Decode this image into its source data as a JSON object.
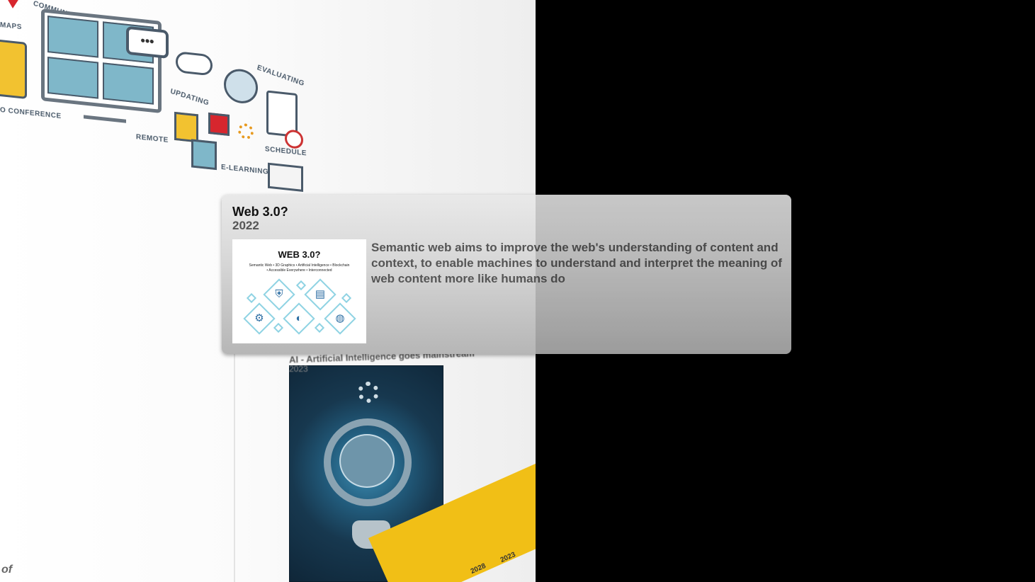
{
  "popup": {
    "title": "Web 3.0?",
    "year": "2022",
    "thumbnail": {
      "heading": "WEB 3.0?",
      "subtitle_line1": "Semantic Web • 3D Graphics • Artificial Intelligence • Blockchain",
      "subtitle_line2": "• Accessible Everywhere • Interconnected",
      "icons": [
        "shield-lock-icon",
        "document-search-icon",
        "gear-network-icon",
        "3d-face-icon",
        "globe-hand-icon"
      ]
    },
    "description": "Semantic web aims to improve the web's understanding of content and context, to enable machines to understand and interpret the meaning of web content more like humans do"
  },
  "background": {
    "collage_labels": [
      "COMMUNICATION",
      "MAPS",
      "EVALUATING",
      "UPDATING",
      "O CONFERENCE",
      "REMOTE",
      "SCHEDULE",
      "E-LEARNING"
    ],
    "speech_bubble": "•••",
    "next_card": {
      "title": "AI - Artificial Intelligence goes mainstream",
      "year": "2023"
    },
    "timeline_ticks": [
      "2028",
      "2023"
    ],
    "corner_text": "of"
  },
  "colors": {
    "accent_yellow": "#f1bf16",
    "accent_red": "#d7262e",
    "icon_teal": "#7fb7c9"
  }
}
